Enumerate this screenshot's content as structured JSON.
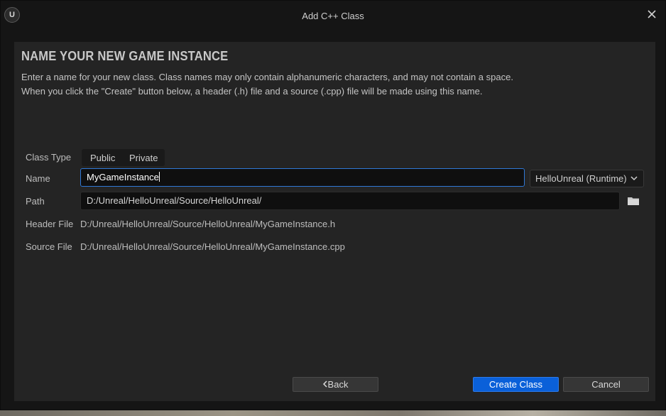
{
  "window": {
    "title": "Add C++ Class",
    "logo_glyph": "U"
  },
  "dialog": {
    "heading": "NAME YOUR NEW GAME INSTANCE",
    "description_line1": "Enter a name for your new class. Class names may only contain alphanumeric characters, and may not contain a space.",
    "description_line2": "When you click the \"Create\" button below, a header (.h) file and a source (.cpp) file will be made using this name."
  },
  "form": {
    "class_type_label": "Class Type",
    "class_type_options": [
      "Public",
      "Private"
    ],
    "name_label": "Name",
    "name_value": "MyGameInstance",
    "module_value": "HelloUnreal (Runtime)",
    "path_label": "Path",
    "path_value": "D:/Unreal/HelloUnreal/Source/HelloUnreal/",
    "header_file_label": "Header File",
    "header_file_value": "D:/Unreal/HelloUnreal/Source/HelloUnreal/MyGameInstance.h",
    "source_file_label": "Source File",
    "source_file_value": "D:/Unreal/HelloUnreal/Source/HelloUnreal/MyGameInstance.cpp"
  },
  "buttons": {
    "back": "Back",
    "create": "Create Class",
    "cancel": "Cancel"
  },
  "colors": {
    "accent": "#0a60d9",
    "focus_border": "#2f78d6",
    "panel_bg": "#242424",
    "window_bg": "#151515"
  },
  "icons": {
    "logo": "unreal-logo-icon",
    "close": "close-icon",
    "module_dropdown": "chevron-down-icon",
    "path_browse": "folder-icon",
    "back": "chevron-left-icon"
  }
}
